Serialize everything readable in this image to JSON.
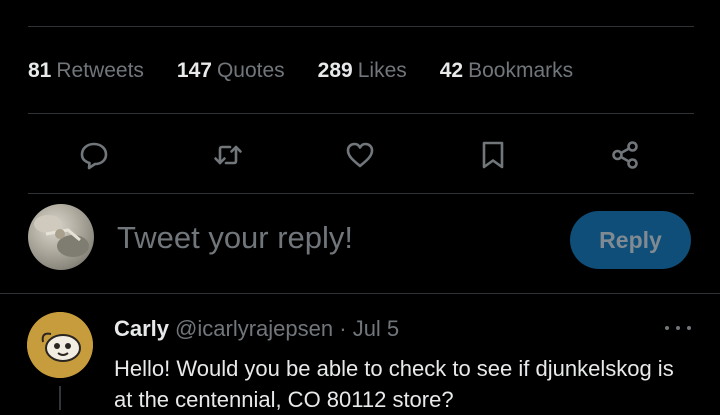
{
  "stats": [
    {
      "count": "81",
      "label": "Retweets"
    },
    {
      "count": "147",
      "label": "Quotes"
    },
    {
      "count": "289",
      "label": "Likes"
    },
    {
      "count": "42",
      "label": "Bookmarks"
    }
  ],
  "actions": {
    "reply_icon": "speech-bubble-icon",
    "retweet_icon": "retweet-arrows-icon",
    "like_icon": "heart-icon",
    "bookmark_icon": "bookmark-icon",
    "share_icon": "share-nodes-icon"
  },
  "compose": {
    "placeholder": "Tweet your reply!",
    "button_label": "Reply"
  },
  "reply": {
    "name": "Carly",
    "handle": "@icarlyrajepsen",
    "separator": "·",
    "date": "Jul 5",
    "text": "Hello! Would you be able to check to see if djunkelskog is at the centennial, CO 80112 store?"
  },
  "colors": {
    "background": "#000000",
    "text": "#e7e9ea",
    "muted": "#71767b",
    "divider": "#2f3336",
    "reply_button_bg": "#0f4e78"
  }
}
